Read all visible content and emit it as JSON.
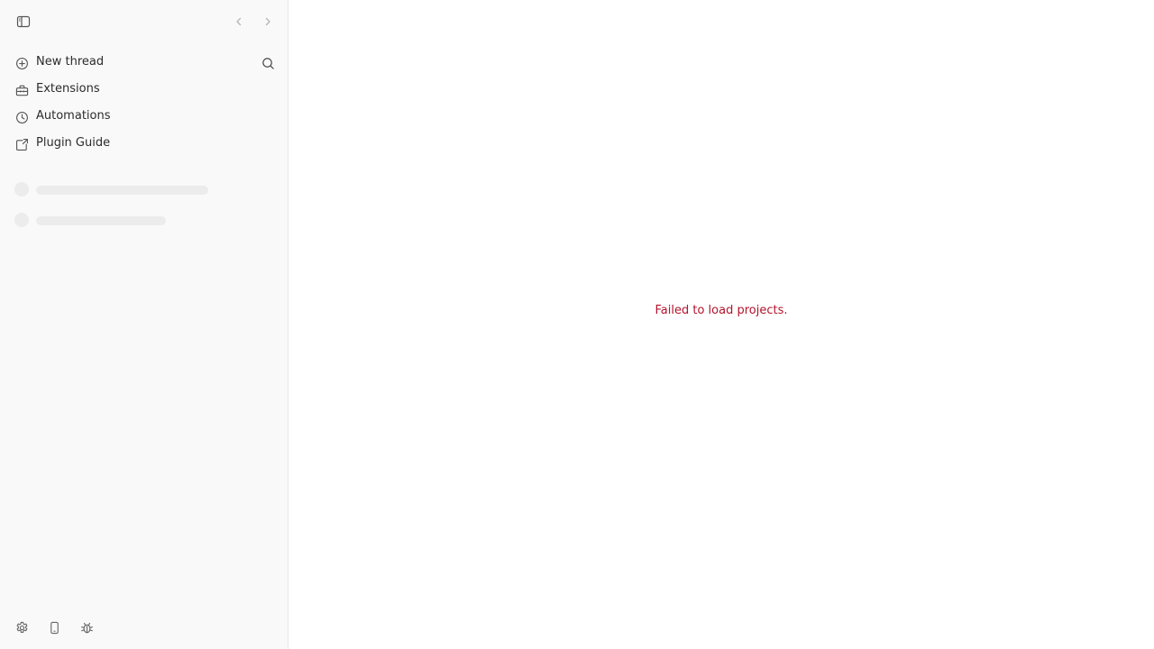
{
  "sidebar": {
    "topbar": {
      "toggle_icon": "sidebar-toggle-icon",
      "back_icon": "chevron-left-icon",
      "forward_icon": "chevron-right-icon"
    },
    "nav": [
      {
        "label": "New thread",
        "icon": "plus-circle-icon"
      },
      {
        "label": "Extensions",
        "icon": "toolbox-icon"
      },
      {
        "label": "Automations",
        "icon": "clock-icon"
      },
      {
        "label": "Plugin Guide",
        "icon": "plugin-icon"
      }
    ],
    "search_icon": "search-icon",
    "bottom_icons": [
      "gear-icon",
      "phone-icon",
      "bug-icon"
    ]
  },
  "main": {
    "error_text": "Failed to load projects.",
    "error_color": "#b3132c"
  }
}
